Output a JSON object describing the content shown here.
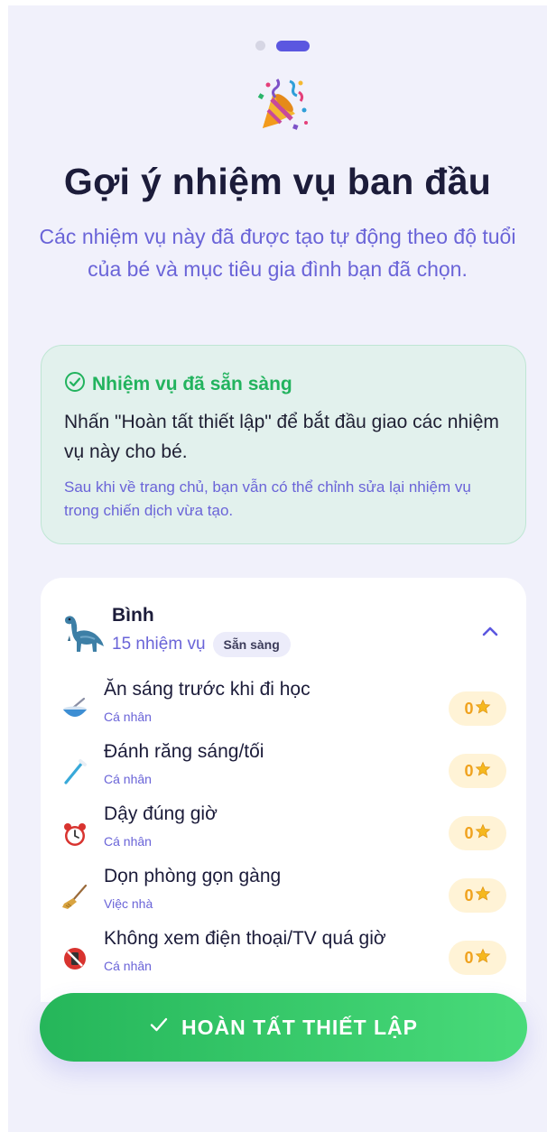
{
  "pager": {
    "total": 2,
    "active": 2
  },
  "header": {
    "icon": "party-popper-icon",
    "title": "Gợi ý nhiệm vụ ban đầu",
    "subtitle": "Các nhiệm vụ này đã được tạo tự động theo độ tuổi của bé và mục tiêu gia đình bạn đã chọn."
  },
  "info": {
    "icon": "check-circle-icon",
    "heading": "Nhiệm vụ đã sẵn sàng",
    "body": "Nhấn \"Hoàn tất thiết lập\" để bắt đầu giao các nhiệm vụ này cho bé.",
    "note": "Sau khi về trang chủ, bạn vẫn có thể chỉnh sửa lại nhiệm vụ trong chiến dịch vừa tạo."
  },
  "kid": {
    "avatar": "dinosaur-icon",
    "name": "Bình",
    "task_count": "15 nhiệm vụ",
    "status": "Sẵn sàng",
    "expanded": true
  },
  "tasks": [
    {
      "name": "Ăn sáng trước khi đi học",
      "category": "Cá nhân",
      "points": "0",
      "icon": "bowl-icon"
    },
    {
      "name": "Đánh răng sáng/tối",
      "category": "Cá nhân",
      "points": "0",
      "icon": "toothbrush-icon"
    },
    {
      "name": "Dậy đúng giờ",
      "category": "Cá nhân",
      "points": "0",
      "icon": "alarm-clock-icon"
    },
    {
      "name": "Dọn phòng gọn gàng",
      "category": "Việc nhà",
      "points": "0",
      "icon": "broom-icon"
    },
    {
      "name": "Không xem điện thoại/TV quá giờ",
      "category": "Cá nhân",
      "points": "0",
      "icon": "no-phone-icon"
    }
  ],
  "cta": {
    "label": "HOÀN TẤT THIẾT LẬP",
    "icon": "checkmark-icon"
  },
  "colors": {
    "accent": "#5b57e0",
    "text_secondary": "#6a64d8",
    "success": "#22b35e",
    "info_bg": "#e2f1ed",
    "points_bg": "#fff3d6",
    "star": "#f5b81f",
    "cta_start": "#25b65a",
    "cta_end": "#49db7a"
  }
}
